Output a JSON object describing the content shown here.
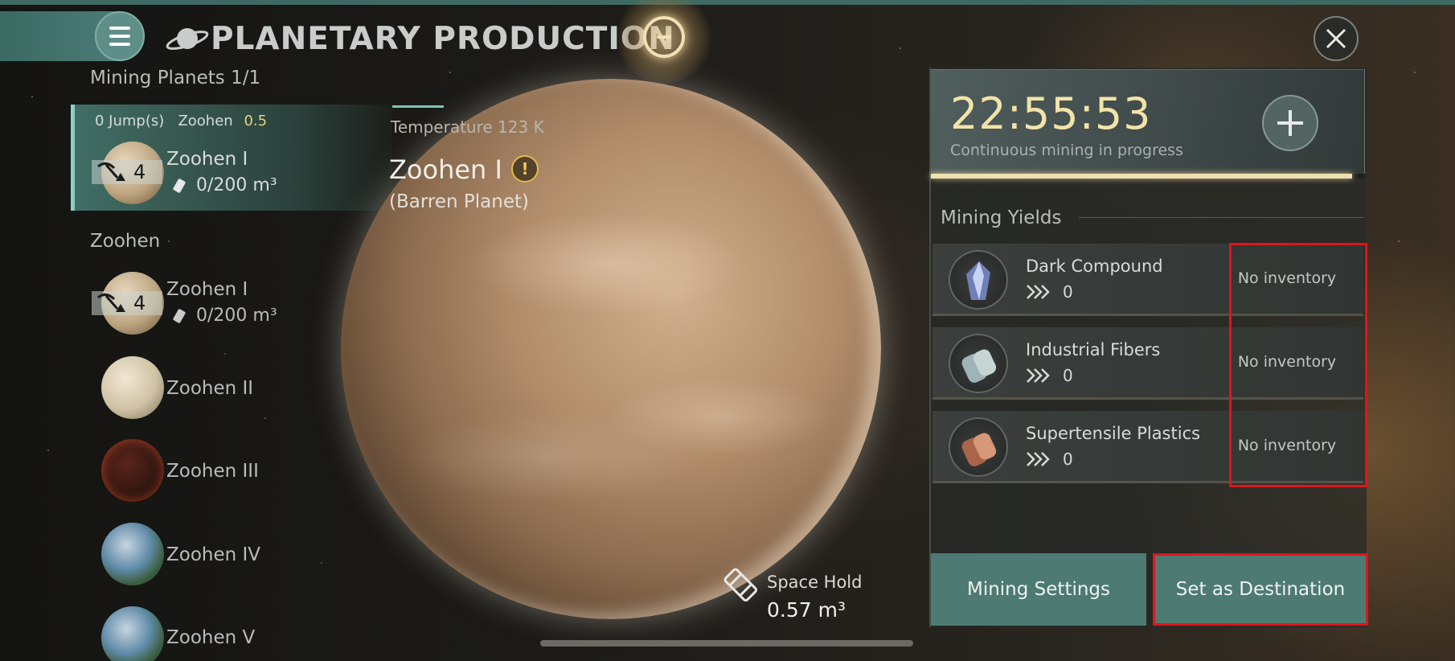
{
  "header": {
    "title": "PLANETARY PRODUCTION",
    "icons": {
      "menu": "hamburger-icon",
      "planet": "ringed-planet-icon",
      "center": "orbit-emblem-icon",
      "close": "close-icon"
    }
  },
  "sidebar": {
    "mining_count": "Mining Planets 1/1",
    "selected": {
      "jumps": "0 Jump(s)",
      "system": "Zoohen",
      "security": "0.5",
      "name": "Zoohen I",
      "miners": "4",
      "cargo": "0/200 m³"
    },
    "group_label": "Zoohen",
    "planets": [
      {
        "name": "Zoohen I",
        "miners": "4",
        "cargo": "0/200 m³",
        "kind": "barren"
      },
      {
        "name": "Zoohen II",
        "kind": "pale"
      },
      {
        "name": "Zoohen III",
        "kind": "lava"
      },
      {
        "name": "Zoohen IV",
        "kind": "terrestrial"
      },
      {
        "name": "Zoohen V",
        "kind": "terrestrial"
      }
    ]
  },
  "center": {
    "temperature": "Temperature 123 K",
    "planet_name": "Zoohen I",
    "planet_type": "(Barren Planet)",
    "warning_glyph": "!",
    "space_hold_label": "Space Hold",
    "space_hold_value": "0.57 m³"
  },
  "panel": {
    "timer": "22:55:53",
    "status": "Continuous mining in progress",
    "progress": 0.97,
    "yields_label": "Mining Yields",
    "yields": [
      {
        "name": "Dark Compound",
        "rate": "0",
        "inventory": "No inventory",
        "icon": "crystal-icon"
      },
      {
        "name": "Industrial Fibers",
        "rate": "0",
        "inventory": "No inventory",
        "icon": "fiber-rolls-icon"
      },
      {
        "name": "Supertensile Plastics",
        "rate": "0",
        "inventory": "No inventory",
        "icon": "plastic-rolls-icon"
      }
    ],
    "buttons": {
      "mining_settings": "Mining Settings",
      "set_destination": "Set as Destination"
    }
  },
  "colors": {
    "accent_teal": "#4d7a73",
    "timer_gold": "#f2e3a8",
    "security_yellow": "#e8d27a",
    "highlight_red": "#e0141b"
  }
}
